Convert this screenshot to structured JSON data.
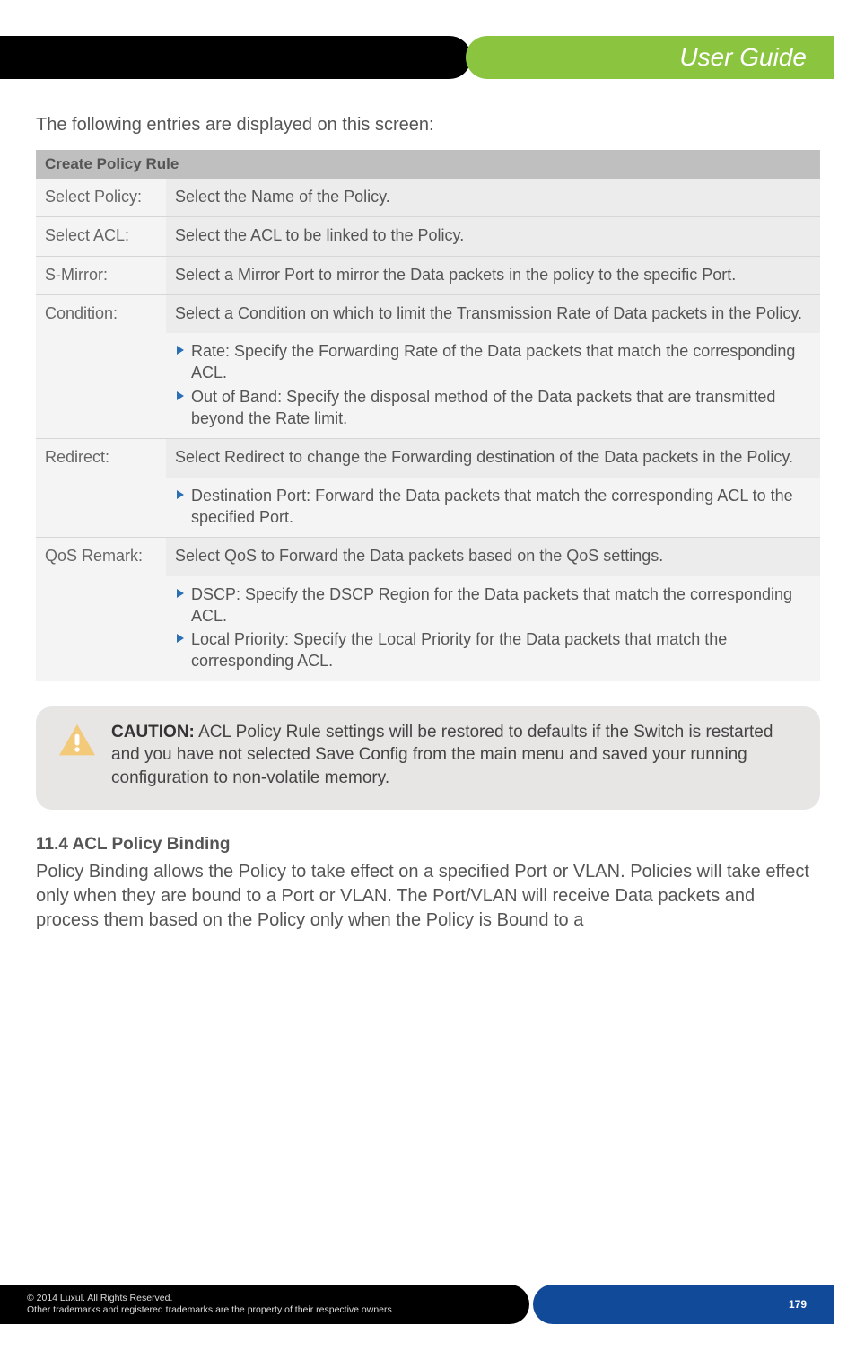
{
  "header": {
    "title": "User Guide"
  },
  "intro": "The following entries are displayed on this screen:",
  "table": {
    "header": "Create Policy Rule",
    "rows": {
      "select_policy": {
        "label": "Select Policy:",
        "desc": "Select the Name of the Policy."
      },
      "select_acl": {
        "label": "Select ACL:",
        "desc": "Select the ACL to be linked to the Policy."
      },
      "s_mirror": {
        "label": "S-Mirror:",
        "desc": "Select a Mirror Port to mirror the Data packets in the policy to the specific Port."
      },
      "condition": {
        "label": "Condition:",
        "desc": "Select a Condition on which to limit the Transmission Rate of Data packets in the Policy.",
        "bullets": [
          "Rate: Specify the Forwarding Rate of the Data packets that match the corresponding ACL.",
          "Out of Band: Specify the disposal method of the Data packets that are transmitted beyond the Rate limit."
        ]
      },
      "redirect": {
        "label": "Redirect:",
        "desc": "Select Redirect to change the Forwarding destination of the Data packets in the Policy.",
        "bullets": [
          "Destination Port: Forward the Data packets that match the corresponding ACL to the specified Port."
        ]
      },
      "qos_remark": {
        "label": "QoS Remark:",
        "desc": "Select QoS to Forward the Data packets based on the QoS settings.",
        "bullets": [
          "DSCP: Specify the DSCP Region for the Data packets that match the corresponding ACL.",
          "Local Priority: Specify the Local Priority for the Data packets that match the corresponding ACL."
        ]
      }
    }
  },
  "caution": {
    "label": "CAUTION:",
    "text": " ACL Policy Rule settings will be restored to defaults if the Switch is restarted and you have not selected Save Config from the main menu and saved your running configuration to non-volatile memory."
  },
  "section": {
    "heading": "11.4 ACL Policy Binding",
    "body": "Policy Binding allows the Policy to take effect on a specified Port or VLAN. Policies will take effect only when they are bound to a Port or VLAN. The Port/VLAN will receive Data packets and process them based on the Policy only when the Policy is Bound to a"
  },
  "footer": {
    "line1": "© 2014  Luxul. All Rights Reserved.",
    "line2": "Other trademarks and registered trademarks are the property of their respective owners",
    "page": "179"
  }
}
